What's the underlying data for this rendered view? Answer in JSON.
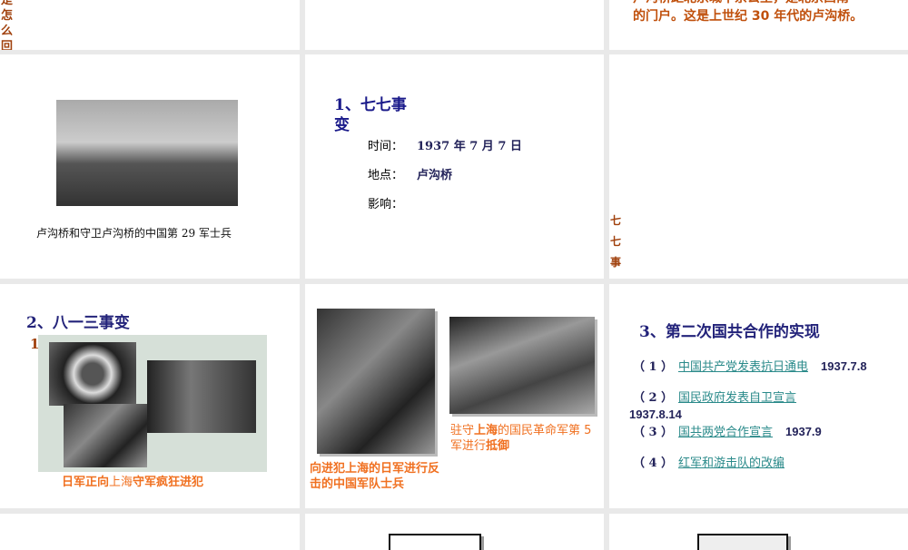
{
  "slides": {
    "s1": {
      "vertical_text": "是怎么回"
    },
    "s3": {
      "text_line1": "卢沟桥距北京城十余公里，是北京西南",
      "text_line2": "的门户。这是上世纪 30 年代的卢沟桥。"
    },
    "s4": {
      "caption": "卢沟桥和守卫卢沟桥的中国第 29 军士兵"
    },
    "s5": {
      "title_line1": "1、七七事",
      "title_line2": "变",
      "time_label": "时间：",
      "time_value": "1937 年 7 月 7 日",
      "place_label": "地点：",
      "place_value": "卢沟桥",
      "impact_label": "影响："
    },
    "s6": {
      "vertical_text": "七七事"
    },
    "s7": {
      "title": "2、八一三事变",
      "marker": "1",
      "caption_a": "日军正向",
      "caption_b": "上海",
      "caption_c": "守军疯狂进犯"
    },
    "s8": {
      "caption_left": "向进犯上海的日军进行反击的中国军队士兵",
      "caption_right_a": "驻守",
      "caption_right_b": "上海",
      "caption_right_c": "的国民革命军第 5 军进行",
      "caption_right_d": "抵御"
    },
    "s9": {
      "title": "3、第二次国共合作的实现",
      "items": [
        {
          "num": "（ 1 ）",
          "text": "中国共产党发表抗日通电",
          "date": "1937.7.8"
        },
        {
          "num": "（ 2 ）",
          "text": "国民政府发表自卫宣言",
          "date": "1937.8.14"
        },
        {
          "num": "（ 3 ）",
          "text": "国共两党合作宣言",
          "date": "1937.9"
        },
        {
          "num": "（ 4 ）",
          "text": "红军和游击队的改编",
          "date": ""
        }
      ]
    }
  }
}
